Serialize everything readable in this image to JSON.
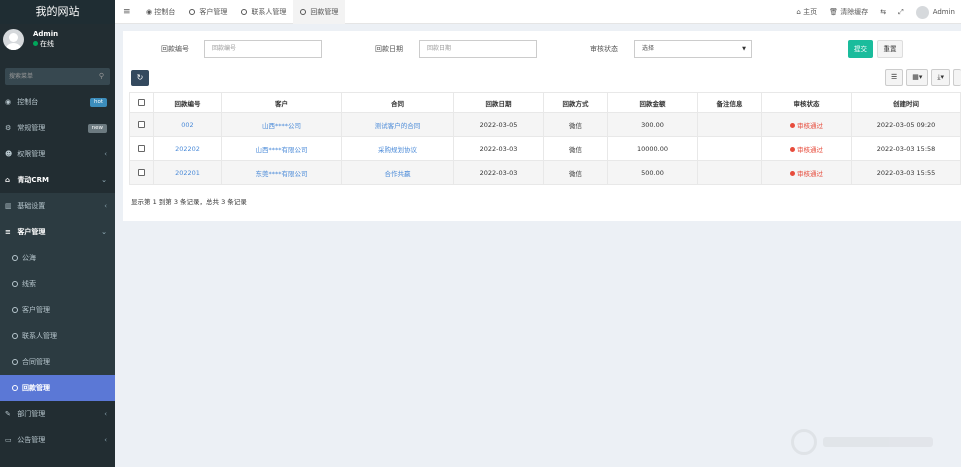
{
  "sidebar": {
    "brand": "我的网站",
    "user": {
      "name": "Admin",
      "status": "在线"
    },
    "search_placeholder": "搜索菜单",
    "items": [
      {
        "label": "控制台",
        "icon": "dashboard-icon",
        "icon_glyph": "◉",
        "badge": "hot"
      },
      {
        "label": "常规管理",
        "icon": "cogs-icon",
        "icon_glyph": "⚙",
        "badge": "new"
      },
      {
        "label": "权限管理",
        "icon": "group-icon",
        "icon_glyph": "☻"
      },
      {
        "label": "青动CRM",
        "icon": "home-icon",
        "icon_glyph": "⌂"
      }
    ],
    "crm_sub": [
      {
        "label": "基础设置",
        "icon": "bank-icon",
        "icon_glyph": "▥"
      },
      {
        "label": "客户管理",
        "icon": "sliders-icon",
        "icon_glyph": "≡"
      }
    ],
    "customer_sub": [
      {
        "label": "公海"
      },
      {
        "label": "线索"
      },
      {
        "label": "客户管理"
      },
      {
        "label": "联系人管理"
      },
      {
        "label": "合同管理"
      },
      {
        "label": "回款管理"
      }
    ],
    "bottom": [
      {
        "label": "部门管理",
        "icon": "pencil-icon",
        "icon_glyph": "✎"
      },
      {
        "label": "公告管理",
        "icon": "credit-card-icon",
        "icon_glyph": "▭"
      }
    ]
  },
  "topbar": {
    "tabs": [
      {
        "label": "控制台"
      },
      {
        "label": "客户管理"
      },
      {
        "label": "联系人管理"
      },
      {
        "label": "回款管理"
      }
    ],
    "right": {
      "home": "主页",
      "clear_cache": "清除缓存",
      "user": "Admin"
    }
  },
  "filter": {
    "code_label": "回款编号",
    "code_placeholder": "回款编号",
    "date_label": "回款日期",
    "date_placeholder": "回款日期",
    "status_label": "审核状态",
    "status_value": "选择",
    "submit": "提交",
    "reset": "重置"
  },
  "table": {
    "headers": [
      "回款编号",
      "客户",
      "合同",
      "回款日期",
      "回款方式",
      "回款金额",
      "备注信息",
      "审核状态",
      "创建时间"
    ],
    "rows": [
      {
        "code": "002",
        "customer": "山西****公司",
        "contract": "测试客户的合同",
        "date": "2022-03-05",
        "method": "微信",
        "amount": "300.00",
        "note": "",
        "status": "审核通过",
        "created": "2022-03-05 09:20"
      },
      {
        "code": "202202",
        "customer": "山西****有限公司",
        "contract": "采购规划协议",
        "date": "2022-03-03",
        "method": "微信",
        "amount": "10000.00",
        "note": "",
        "status": "审核通过",
        "created": "2022-03-03 15:58"
      },
      {
        "code": "202201",
        "customer": "东莞****有限公司",
        "contract": "合作共赢",
        "date": "2022-03-03",
        "method": "微信",
        "amount": "500.00",
        "note": "",
        "status": "审核通过",
        "created": "2022-03-03 15:55"
      }
    ],
    "summary": "显示第 1 到第 3 条记录，总共 3 条记录"
  },
  "colors": {
    "sidebar_bg": "#222d32",
    "active_item": "#5b78d6",
    "submit_btn": "#1abc9c",
    "link": "#4a8ad8",
    "status_red": "#e74c3c"
  }
}
